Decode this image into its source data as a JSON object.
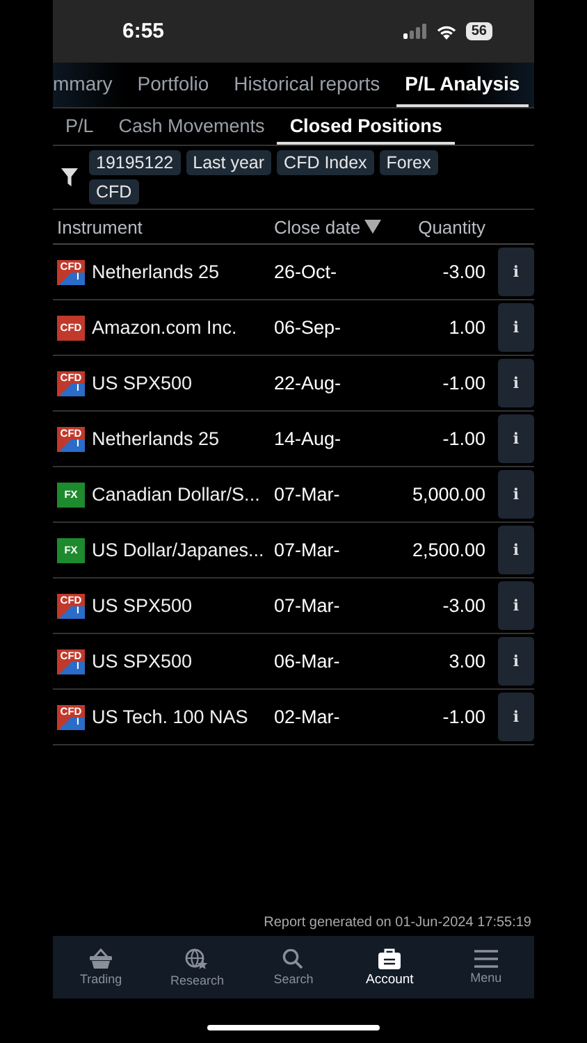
{
  "status_bar": {
    "time": "6:55",
    "battery": "56"
  },
  "main_tabs": [
    {
      "label": "mmary",
      "selected": false
    },
    {
      "label": "Portfolio",
      "selected": false
    },
    {
      "label": "Historical reports",
      "selected": false
    },
    {
      "label": "P/L Analysis",
      "selected": true
    }
  ],
  "sub_tabs": [
    {
      "label": "P/L",
      "selected": false
    },
    {
      "label": "Cash Movements",
      "selected": false
    },
    {
      "label": "Closed Positions",
      "selected": true
    }
  ],
  "filters": [
    "19195122",
    "Last year",
    "CFD Index",
    "Forex",
    "CFD"
  ],
  "table": {
    "columns": [
      {
        "label": "Instrument",
        "sorted": false
      },
      {
        "label": "Close date",
        "sorted": true
      },
      {
        "label": "Quantity",
        "sorted": false
      }
    ],
    "rows": [
      {
        "badge": {
          "kind": "cfd_index",
          "text": "CFD",
          "sub": "I"
        },
        "instrument": "Netherlands 25",
        "date": "26-Oct-",
        "quantity": "-3.00",
        "info": "i"
      },
      {
        "badge": {
          "kind": "cfd",
          "text": "CFD"
        },
        "instrument": "Amazon.com Inc.",
        "date": "06-Sep-",
        "quantity": "1.00",
        "info": "i"
      },
      {
        "badge": {
          "kind": "cfd_index",
          "text": "CFD",
          "sub": "I"
        },
        "instrument": "US SPX500",
        "date": "22-Aug-",
        "quantity": "-1.00",
        "info": "i"
      },
      {
        "badge": {
          "kind": "cfd_index",
          "text": "CFD",
          "sub": "I"
        },
        "instrument": "Netherlands 25",
        "date": "14-Aug-",
        "quantity": "-1.00",
        "info": "i"
      },
      {
        "badge": {
          "kind": "fx",
          "text": "FX"
        },
        "instrument": "Canadian Dollar/S...",
        "date": "07-Mar-",
        "quantity": "5,000.00",
        "info": "i"
      },
      {
        "badge": {
          "kind": "fx",
          "text": "FX"
        },
        "instrument": "US Dollar/Japanes...",
        "date": "07-Mar-",
        "quantity": "2,500.00",
        "info": "i"
      },
      {
        "badge": {
          "kind": "cfd_index",
          "text": "CFD",
          "sub": "I"
        },
        "instrument": "US SPX500",
        "date": "07-Mar-",
        "quantity": "-3.00",
        "info": "i"
      },
      {
        "badge": {
          "kind": "cfd_index",
          "text": "CFD",
          "sub": "I"
        },
        "instrument": "US SPX500",
        "date": "06-Mar-",
        "quantity": "3.00",
        "info": "i"
      },
      {
        "badge": {
          "kind": "cfd_index",
          "text": "CFD",
          "sub": "I"
        },
        "instrument": "US Tech. 100 NAS",
        "date": "02-Mar-",
        "quantity": "-1.00",
        "info": "i"
      }
    ]
  },
  "report_note": "Report generated on 01-Jun-2024 17:55:19",
  "nav": [
    {
      "kind": "basket",
      "label": "Trading",
      "selected": false
    },
    {
      "kind": "globe",
      "label": "Research",
      "selected": false
    },
    {
      "kind": "search",
      "label": "Search",
      "selected": false
    },
    {
      "kind": "briefcase",
      "label": "Account",
      "selected": true
    },
    {
      "kind": "menu",
      "label": "Menu",
      "selected": false
    }
  ]
}
